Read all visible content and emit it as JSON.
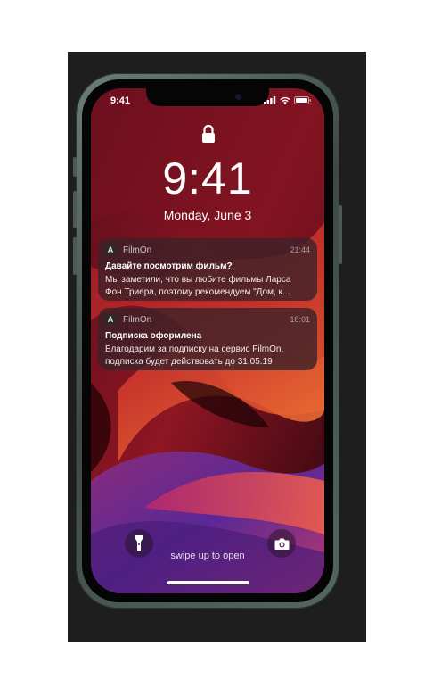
{
  "status_bar": {
    "time": "9:41",
    "icons": [
      "cellular-signal-icon",
      "wifi-icon",
      "battery-icon"
    ]
  },
  "lock_screen": {
    "lock_icon": "padlock-icon",
    "clock": "9:41",
    "date": "Monday, June 3",
    "swipe_hint": "swipe up to open",
    "flashlight_icon": "flashlight-icon",
    "camera_icon": "camera-icon"
  },
  "notifications": [
    {
      "app_icon_letter": "A",
      "app_name": "FilmOn",
      "time": "21:44",
      "title": "Давайте посмотрим фильм?",
      "body_lines": [
        "Мы заметили, что вы любите фильмы Ларса",
        "Фон Триера, поэтому рекомендуем \"Дом, к..."
      ]
    },
    {
      "app_icon_letter": "A",
      "app_name": "FilmOn",
      "time": "18:01",
      "title": "Подписка оформлена",
      "body_lines": [
        "Благодарим за подписку на сервис FilmOn,",
        "подписка будет действовать до 31.05.19"
      ]
    }
  ],
  "colors": {
    "background_frame": "#1e1e1e",
    "phone_body": "#4b5a52",
    "wallpaper_dark": "#120306",
    "wallpaper_red": "#b0202a",
    "wallpaper_orange": "#e8552c",
    "wallpaper_purple": "#6a2ea0"
  }
}
